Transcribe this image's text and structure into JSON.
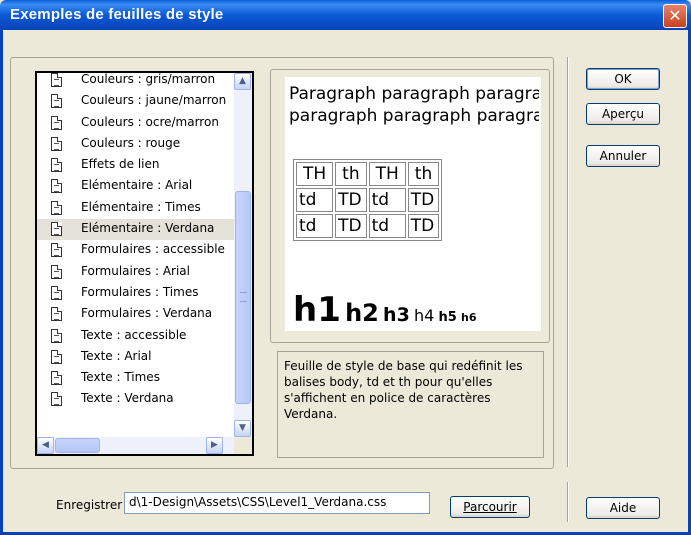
{
  "window": {
    "title": "Exemples de feuilles de style",
    "close_label": "✕"
  },
  "list": {
    "items": [
      "Couleurs : gris/marron",
      "Couleurs : jaune/marron",
      "Couleurs : ocre/marron",
      "Couleurs : rouge",
      "Effets de lien",
      "Elémentaire : Arial",
      "Elémentaire : Times",
      "Elémentaire : Verdana",
      "Formulaires : accessible",
      "Formulaires : Arial",
      "Formulaires : Times",
      "Formulaires : Verdana",
      "Texte : accessible",
      "Texte : Arial",
      "Texte : Times",
      "Texte : Verdana"
    ],
    "selected_index": 7
  },
  "preview": {
    "paragraph_line1": "Paragraph paragraph paragraph",
    "paragraph_line2": "paragraph paragraph paragraph",
    "table": {
      "headers": [
        "TH",
        "th",
        "TH",
        "th"
      ],
      "rows": [
        [
          "td",
          "TD",
          "td",
          "TD"
        ],
        [
          "td",
          "TD",
          "td",
          "TD"
        ]
      ]
    },
    "headings": [
      "h1",
      "h2",
      "h3",
      "h4",
      "h5",
      "h6"
    ]
  },
  "description": "Feuille de style de base qui redéfinit les balises body, td et th pour qu'elles s'affichent en police de caractères Verdana.",
  "buttons": {
    "ok": "OK",
    "preview": "Aperçu",
    "cancel": "Annuler",
    "help": "Aide",
    "browse": "Parcourir"
  },
  "save": {
    "label": "Enregistrer",
    "path": "d\\1-Design\\Assets\\CSS\\Level1_Verdana.css"
  }
}
